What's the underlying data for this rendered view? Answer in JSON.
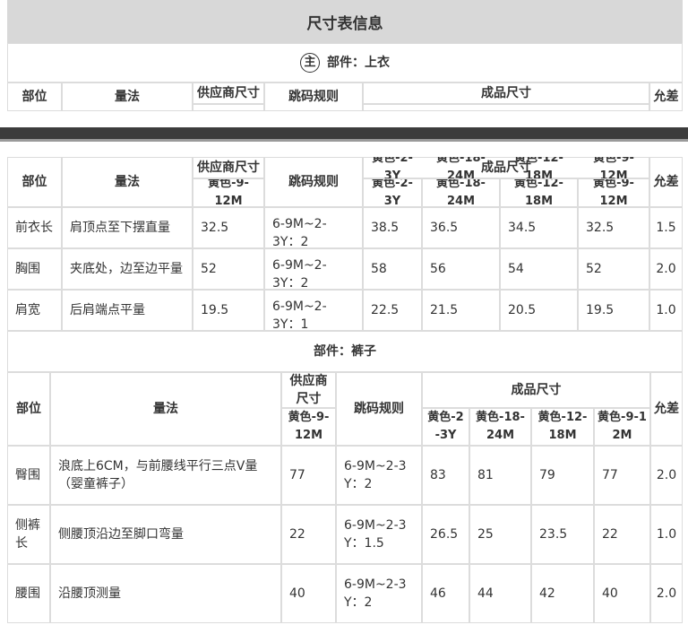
{
  "page_title": "尺寸表信息",
  "top_part": {
    "badge": "主",
    "label": "部件：上衣",
    "headers": {
      "part": "部位",
      "method": "量法",
      "supplier": "供应商尺寸",
      "rule": "跳码规则",
      "finished": "成品尺寸",
      "tolerance": "允差"
    }
  },
  "table1": {
    "headers": {
      "part": "部位",
      "method": "量法",
      "supplier": "供应商尺寸",
      "rule": "跳码规则",
      "finished": "成品尺寸",
      "tolerance": "允差"
    },
    "overlap_sizes": [
      "黄色-2-3Y",
      "黄色-18-24M",
      "黄色-12-18M",
      "黄色-9-12M"
    ],
    "supplier_size": "黄色-9-12M",
    "sizes": [
      "黄色-2-3Y",
      "黄色-18-24M",
      "黄色-12-18M",
      "黄色-9-12M"
    ],
    "rows": [
      {
        "part": "前衣长",
        "method": "肩顶点至下摆直量",
        "supplier": "32.5",
        "rule": "6-9M~2-3Y：2",
        "v1": "38.5",
        "v2": "36.5",
        "v3": "34.5",
        "v4": "32.5",
        "tol": "1.5"
      },
      {
        "part": "胸围",
        "method": "夹底处，边至边平量",
        "supplier": "52",
        "rule": "6-9M~2-3Y：2",
        "v1": "58",
        "v2": "56",
        "v3": "54",
        "v4": "52",
        "tol": "2.0"
      },
      {
        "part": "肩宽",
        "method": "后肩端点平量",
        "supplier": "19.5",
        "rule": "6-9M~2-3Y：1",
        "v1": "22.5",
        "v2": "21.5",
        "v3": "20.5",
        "v4": "19.5",
        "tol": "1.0"
      }
    ]
  },
  "pants_label": "部件：裤子",
  "table2": {
    "headers": {
      "part": "部位",
      "method": "量法",
      "supplier": "供应商尺寸",
      "rule": "跳码规则",
      "finished": "成品尺寸",
      "tolerance": "允差"
    },
    "supplier_size": "黄色-9-12M",
    "sizes": [
      "黄色-2-3Y",
      "黄色-18-24M",
      "黄色-12-18M",
      "黄色-9-12M"
    ],
    "rows": [
      {
        "part": "臀围",
        "method": "浪底上6CM，与前腰线平行三点V量（婴童裤子）",
        "supplier": "77",
        "rule": "6-9M~2-3Y：2",
        "v1": "83",
        "v2": "81",
        "v3": "79",
        "v4": "77",
        "tol": "2.0"
      },
      {
        "part": "侧裤长",
        "method": "侧腰顶沿边至脚口弯量",
        "supplier": "22",
        "rule": "6-9M~2-3Y：1.5",
        "v1": "26.5",
        "v2": "25",
        "v3": "23.5",
        "v4": "22",
        "tol": "1.0"
      },
      {
        "part": "腰围",
        "method": "沿腰顶测量",
        "supplier": "40",
        "rule": "6-9M~2-3Y：2",
        "v1": "46",
        "v2": "44",
        "v3": "42",
        "v4": "40",
        "tol": "2.0"
      }
    ]
  }
}
